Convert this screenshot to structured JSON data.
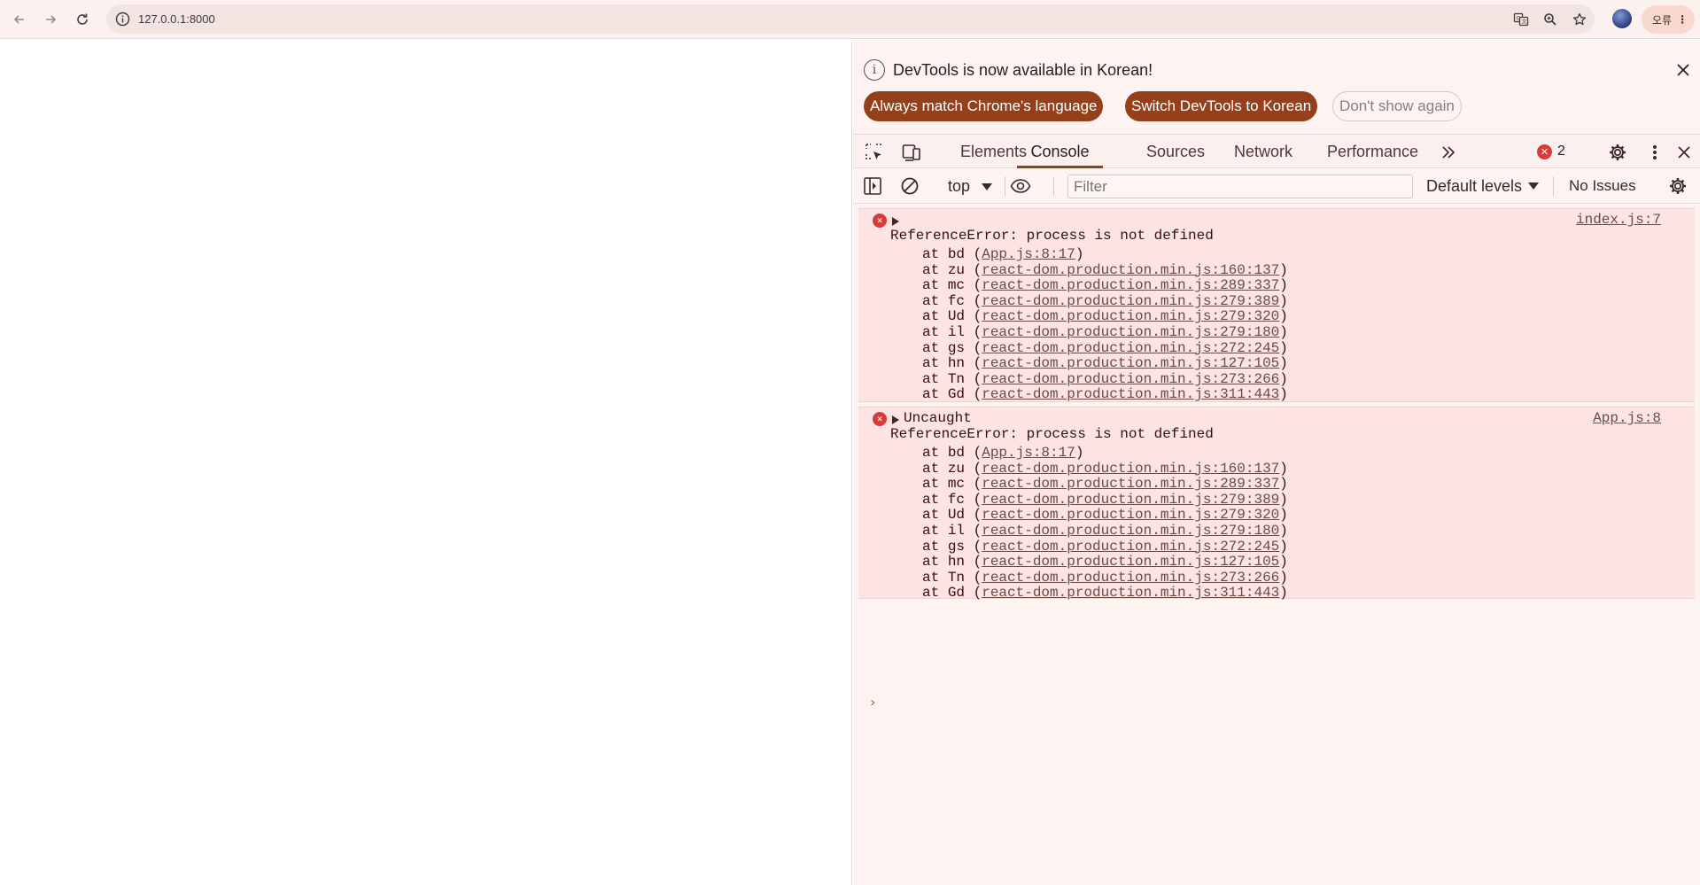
{
  "browser": {
    "url": "127.0.0.1:8000",
    "profile_label": "오류"
  },
  "infobar": {
    "message": "DevTools is now available in Korean!",
    "btn_match": "Always match Chrome's language",
    "btn_switch": "Switch DevTools to Korean",
    "btn_dismiss": "Don't show again"
  },
  "tabs": [
    "Elements",
    "Console",
    "Sources",
    "Network",
    "Performance"
  ],
  "error_count": "2",
  "console_toolbar": {
    "context": "top",
    "filter_placeholder": "Filter",
    "levels": "Default levels",
    "issues": "No Issues"
  },
  "messages": [
    {
      "head": "",
      "source": "index.js:7",
      "error": "ReferenceError: process is not defined",
      "frames": [
        {
          "fn": "bd",
          "loc": "App.js:8:17"
        },
        {
          "fn": "zu",
          "loc": "react-dom.production.min.js:160:137"
        },
        {
          "fn": "mc",
          "loc": "react-dom.production.min.js:289:337"
        },
        {
          "fn": "fc",
          "loc": "react-dom.production.min.js:279:389"
        },
        {
          "fn": "Ud",
          "loc": "react-dom.production.min.js:279:320"
        },
        {
          "fn": "il",
          "loc": "react-dom.production.min.js:279:180"
        },
        {
          "fn": "gs",
          "loc": "react-dom.production.min.js:272:245"
        },
        {
          "fn": "hn",
          "loc": "react-dom.production.min.js:127:105"
        },
        {
          "fn": "Tn",
          "loc": "react-dom.production.min.js:273:266"
        },
        {
          "fn": "Gd",
          "loc": "react-dom.production.min.js:311:443"
        }
      ]
    },
    {
      "head": "Uncaught",
      "source": "App.js:8",
      "error": "ReferenceError: process is not defined",
      "frames": [
        {
          "fn": "bd",
          "loc": "App.js:8:17"
        },
        {
          "fn": "zu",
          "loc": "react-dom.production.min.js:160:137"
        },
        {
          "fn": "mc",
          "loc": "react-dom.production.min.js:289:337"
        },
        {
          "fn": "fc",
          "loc": "react-dom.production.min.js:279:389"
        },
        {
          "fn": "Ud",
          "loc": "react-dom.production.min.js:279:320"
        },
        {
          "fn": "il",
          "loc": "react-dom.production.min.js:279:180"
        },
        {
          "fn": "gs",
          "loc": "react-dom.production.min.js:272:245"
        },
        {
          "fn": "hn",
          "loc": "react-dom.production.min.js:127:105"
        },
        {
          "fn": "Tn",
          "loc": "react-dom.production.min.js:273:266"
        },
        {
          "fn": "Gd",
          "loc": "react-dom.production.min.js:311:443"
        }
      ]
    }
  ],
  "colors": {
    "accent": "#95401b",
    "error": "#d93a3a",
    "error_bg": "#fbe4e1"
  }
}
